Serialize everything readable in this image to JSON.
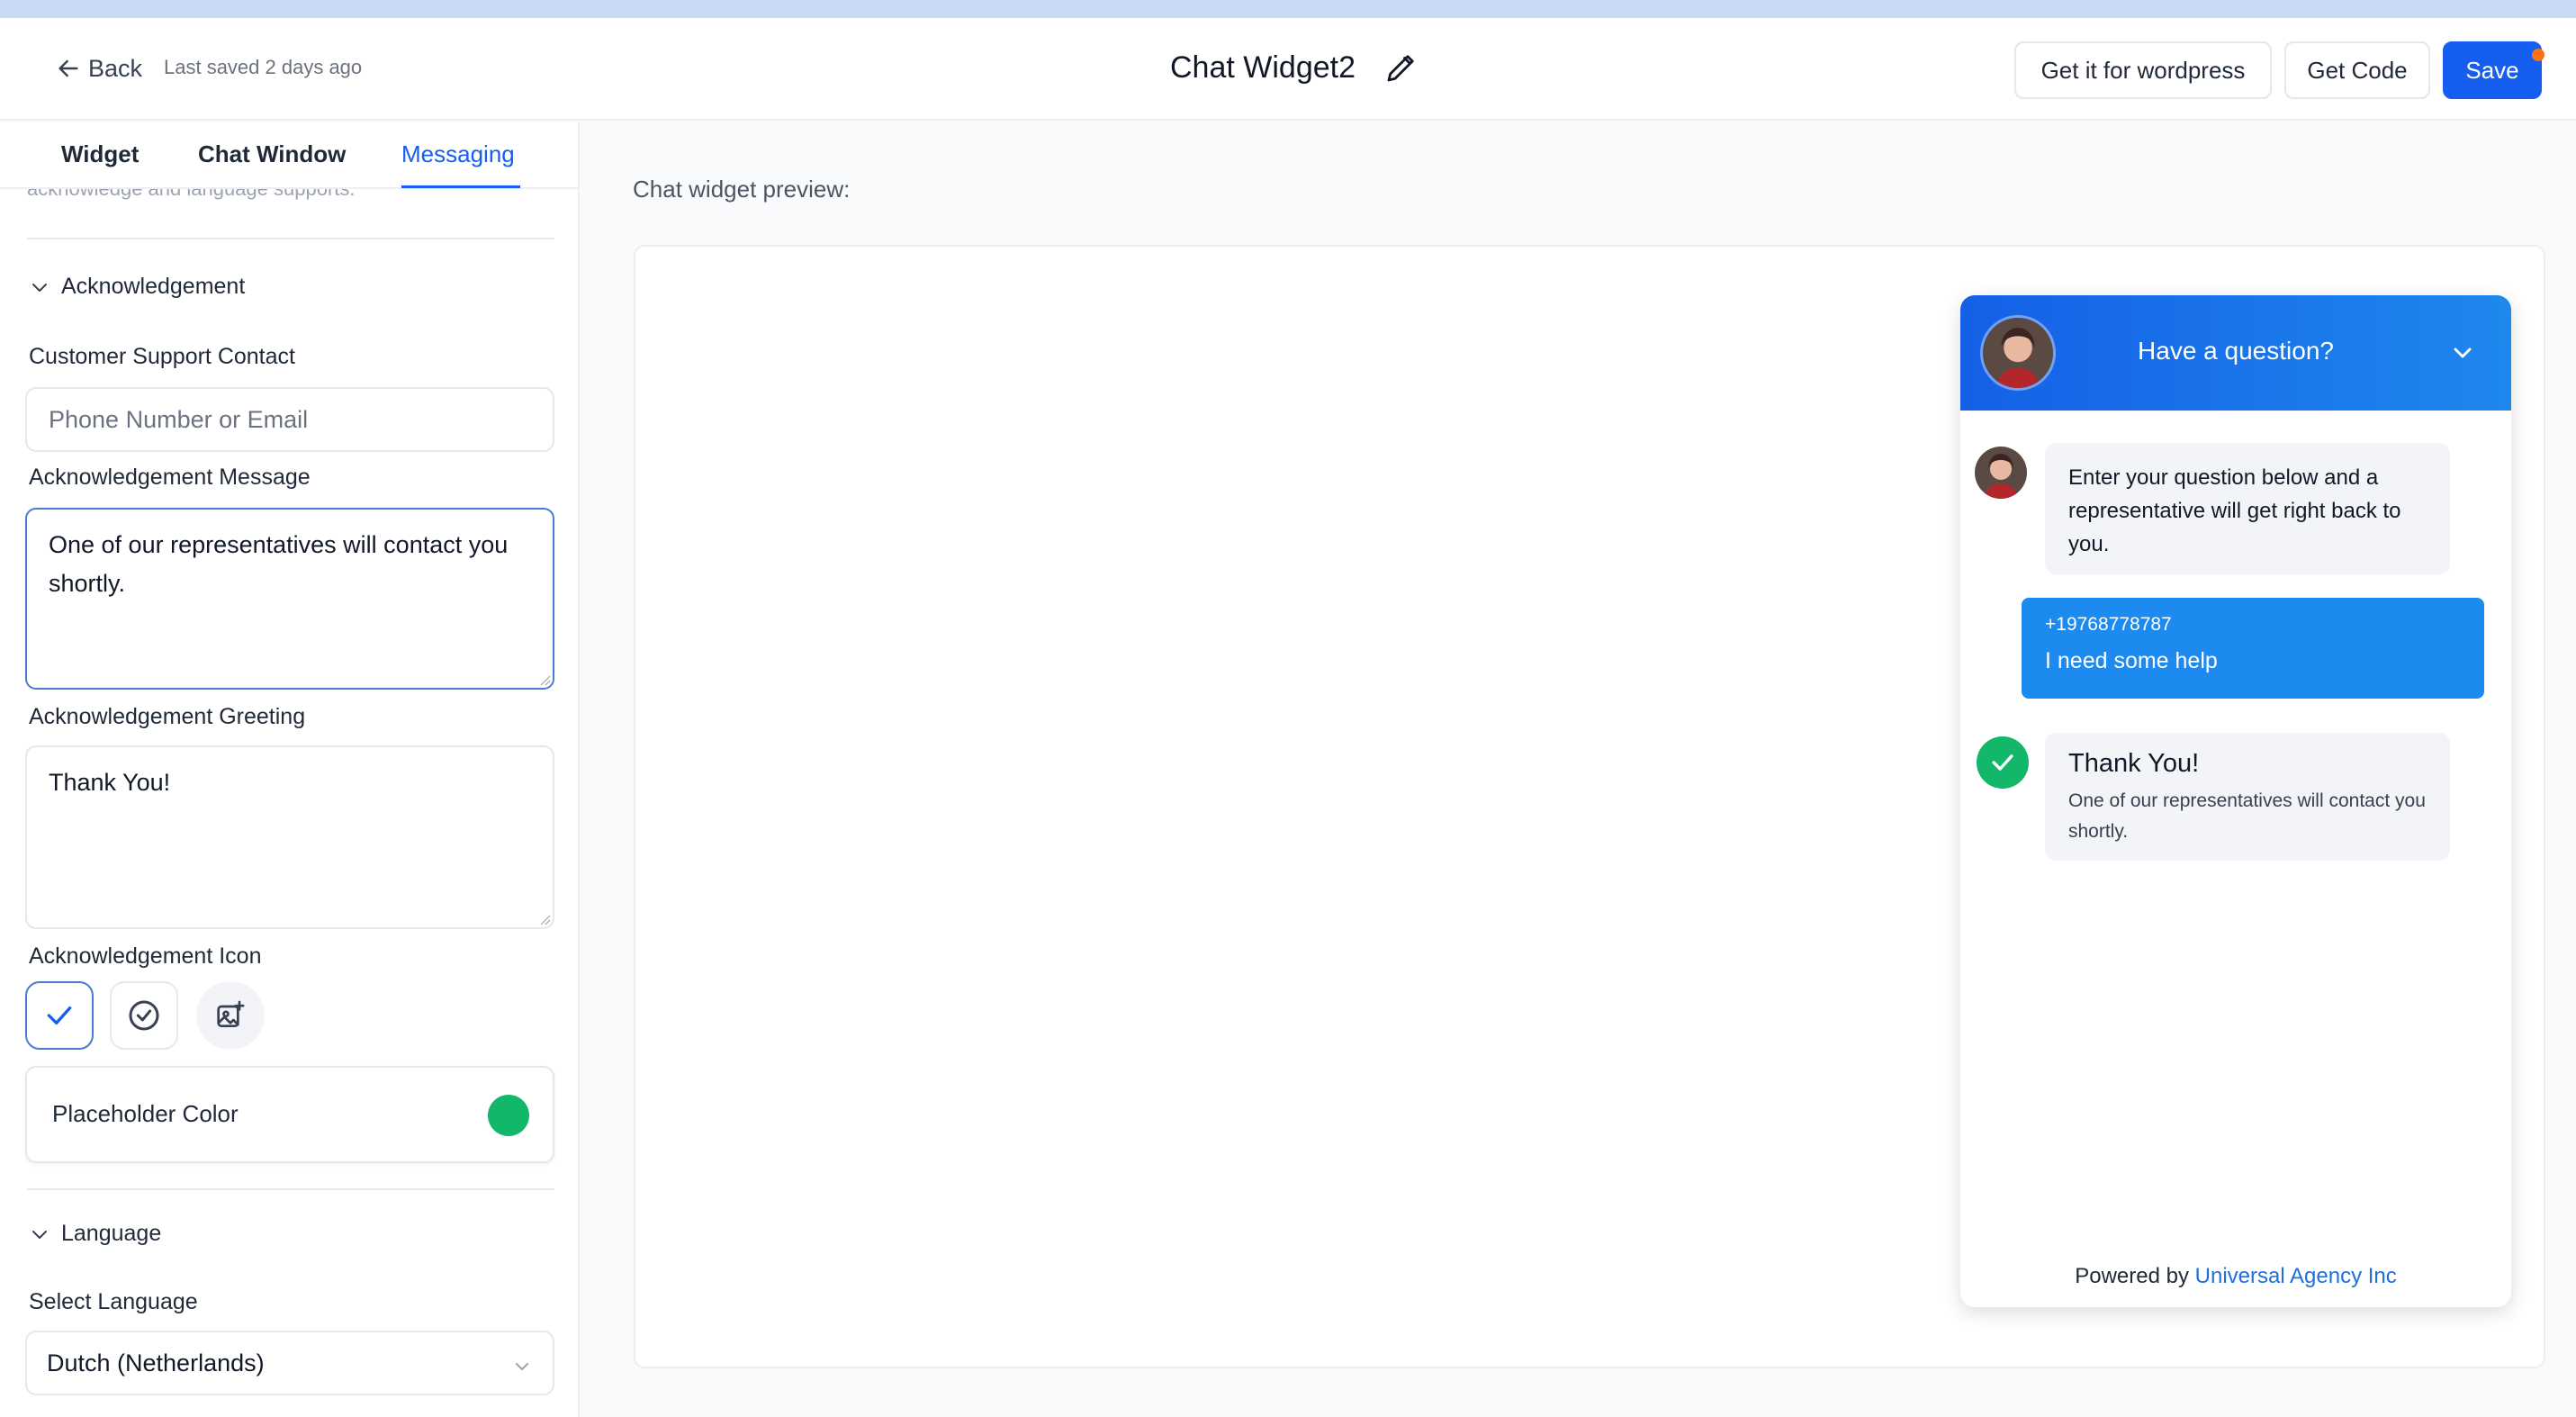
{
  "header": {
    "back_label": "Back",
    "last_saved": "Last saved 2 days ago",
    "widget_title": "Chat Widget2",
    "wordpress_button": "Get it for wordpress",
    "get_code_button": "Get Code",
    "save_button": "Save"
  },
  "tabs": [
    {
      "label": "Widget"
    },
    {
      "label": "Chat Window"
    },
    {
      "label": "Messaging",
      "active": true
    }
  ],
  "left": {
    "cut_text": "acknowledge and language supports.",
    "acknowledgement_section": "Acknowledgement",
    "customer_support_label": "Customer Support Contact",
    "customer_support_placeholder": "Phone Number or Email",
    "ack_message_label": "Acknowledgement Message",
    "ack_message_value": "One of our representatives will contact you shortly.",
    "ack_greeting_label": "Acknowledgement Greeting",
    "ack_greeting_value": "Thank You!",
    "ack_icon_label": "Acknowledgement Icon",
    "icon_options": [
      "check-icon",
      "check-circle-icon",
      "image-upload-icon"
    ],
    "placeholder_color_label": "Placeholder Color",
    "placeholder_color": "#12b76a",
    "language_section": "Language",
    "select_language_label": "Select Language",
    "selected_language": "Dutch (Netherlands)"
  },
  "preview": {
    "label": "Chat widget preview:",
    "widget_header": "Have a question?",
    "bot_message": "Enter your question below and a representative will get right back to you.",
    "user_phone": "+19768778787",
    "user_message": "I need some help",
    "ack_greeting": "Thank You!",
    "ack_message": "One of our representatives will contact you shortly.",
    "powered_by": "Powered by",
    "powered_link": "Universal Agency Inc",
    "header_color": "#1560e6",
    "user_bubble_color": "#1d8af0"
  }
}
